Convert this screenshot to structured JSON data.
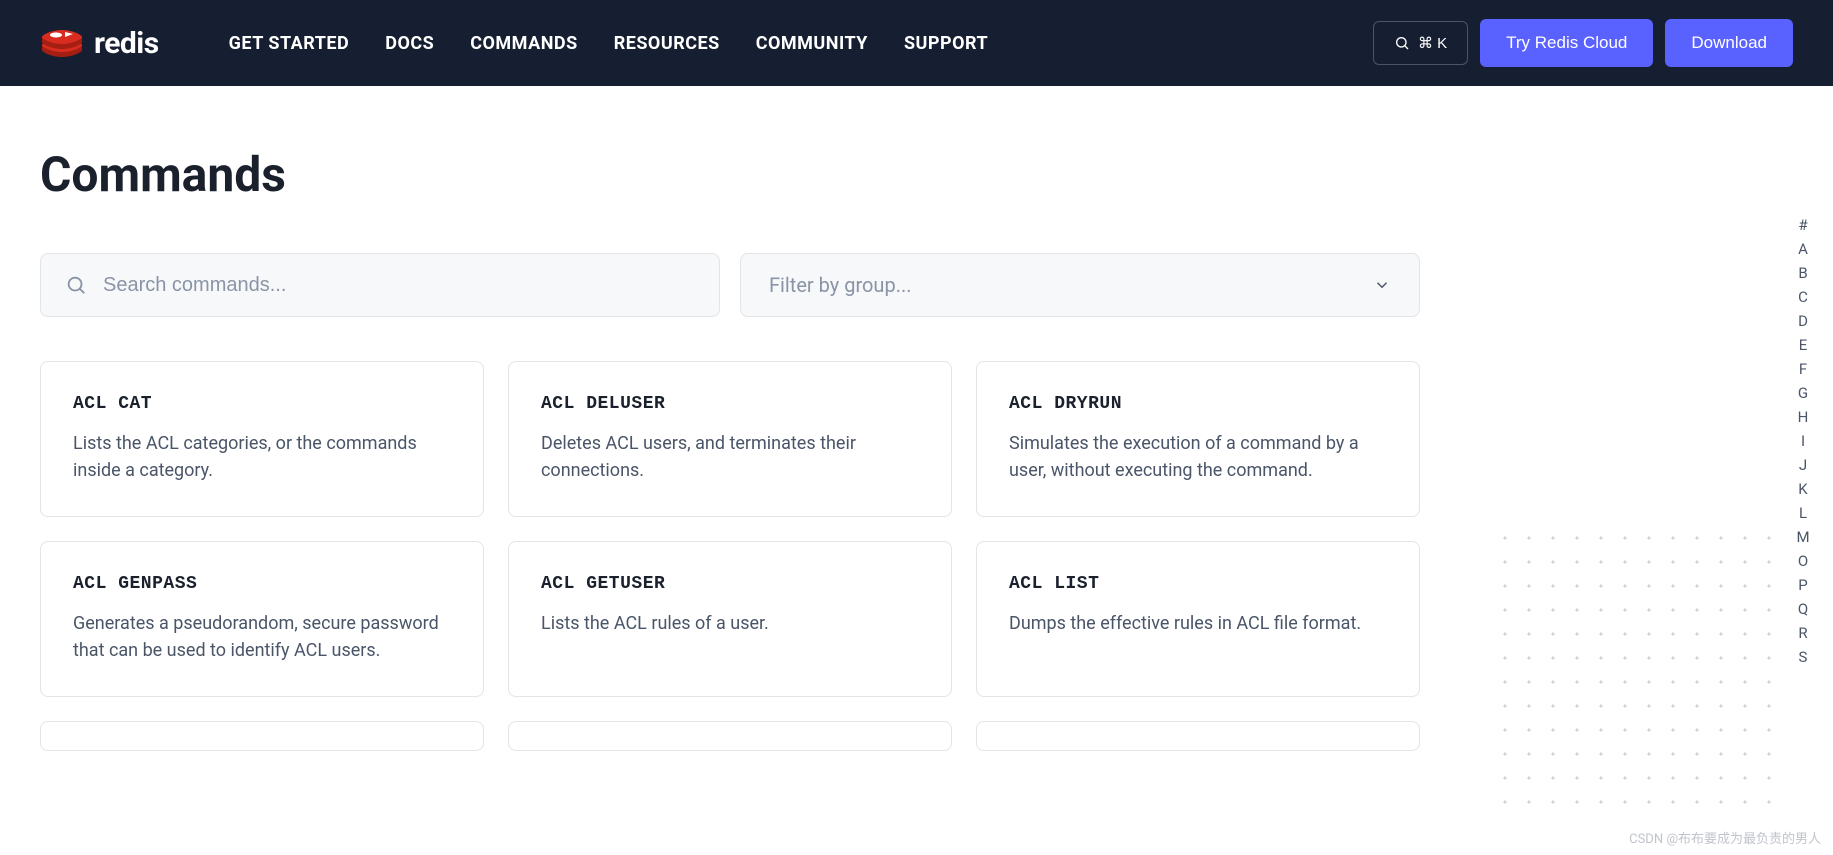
{
  "brand": "redis",
  "nav": [
    "GET STARTED",
    "DOCS",
    "COMMANDS",
    "RESOURCES",
    "COMMUNITY",
    "SUPPORT"
  ],
  "header": {
    "search_shortcut": "⌘ K",
    "try_cloud": "Try Redis Cloud",
    "download": "Download"
  },
  "page": {
    "title": "Commands",
    "search_placeholder": "Search commands...",
    "filter_placeholder": "Filter by group..."
  },
  "commands": [
    {
      "name": "ACL CAT",
      "desc": "Lists the ACL categories, or the commands inside a category."
    },
    {
      "name": "ACL DELUSER",
      "desc": "Deletes ACL users, and terminates their connections."
    },
    {
      "name": "ACL DRYRUN",
      "desc": "Simulates the execution of a command by a user, without executing the command."
    },
    {
      "name": "ACL GENPASS",
      "desc": "Generates a pseudorandom, secure password that can be used to identify ACL users."
    },
    {
      "name": "ACL GETUSER",
      "desc": "Lists the ACL rules of a user."
    },
    {
      "name": "ACL LIST",
      "desc": "Dumps the effective rules in ACL file format."
    }
  ],
  "alpha": [
    "#",
    "A",
    "B",
    "C",
    "D",
    "E",
    "F",
    "G",
    "H",
    "I",
    "J",
    "K",
    "L",
    "M",
    "O",
    "P",
    "Q",
    "R",
    "S"
  ],
  "watermark": "CSDN @布布要成为最负责的男人"
}
